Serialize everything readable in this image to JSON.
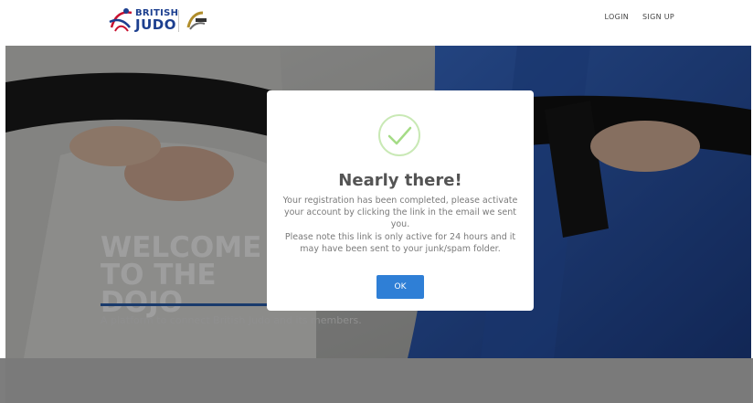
{
  "header": {
    "brand_line1": "BRITISH",
    "brand_line2": "JUDO",
    "nav": {
      "login": "LOGIN",
      "signup": "SIGN UP"
    }
  },
  "hero": {
    "title": "WELCOME TO THE DOJO",
    "subtitle": "A platform to connect British Judo and its members."
  },
  "modal": {
    "title": "Nearly there!",
    "message1": "Your registration has been completed, please activate your account by clicking the link in the email we sent you.",
    "message2": "Please note this link is only active for 24 hours and it may have been sent to your junk/spam folder.",
    "ok_label": "OK"
  },
  "colors": {
    "primary": "#2f7fd6",
    "success": "#a5dc86",
    "brand": "#1c3f8f"
  }
}
